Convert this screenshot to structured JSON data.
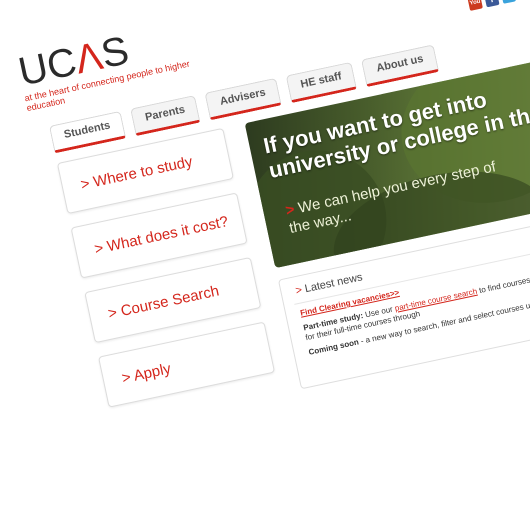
{
  "logo": {
    "word_start": "UC",
    "word_mark": "Λ",
    "word_end": "S",
    "tagline": "at the heart of connecting people to higher education"
  },
  "social": [
    {
      "name": "youtube-icon",
      "glyph": "You",
      "color": "#cc3b1f"
    },
    {
      "name": "facebook-icon",
      "glyph": "f",
      "color": "#3b5998"
    },
    {
      "name": "twitter-icon",
      "glyph": "t",
      "color": "#3aa3dc"
    }
  ],
  "tabs": [
    {
      "label": "Students"
    },
    {
      "label": "Parents"
    },
    {
      "label": "Advisers"
    },
    {
      "label": "HE staff"
    },
    {
      "label": "About us"
    }
  ],
  "nav": [
    {
      "label": "> Where to study"
    },
    {
      "label": "> What does it cost?"
    },
    {
      "label": "> Course Search"
    },
    {
      "label": "> Apply"
    }
  ],
  "hero": {
    "headline": "If you want to get into university or college in the UK",
    "sub_arrow": ">",
    "sub_text": "We can help you every step of the way..."
  },
  "news": {
    "title_arrow": ">",
    "title": "Latest news",
    "clearing_link": "Find Clearing vacancies>>",
    "part_time_label": "Part-time study:",
    "part_time_text": "Use our",
    "part_time_link": "part-time course search",
    "part_time_rest": "to find courses at universities and colleges that recruit for their full-time courses through",
    "coming_soon_label": "Coming soon",
    "coming_soon_text": "- a new way to search, filter and select courses u"
  },
  "colors": {
    "accent": "#d4261c",
    "text": "#2b2b2b"
  }
}
